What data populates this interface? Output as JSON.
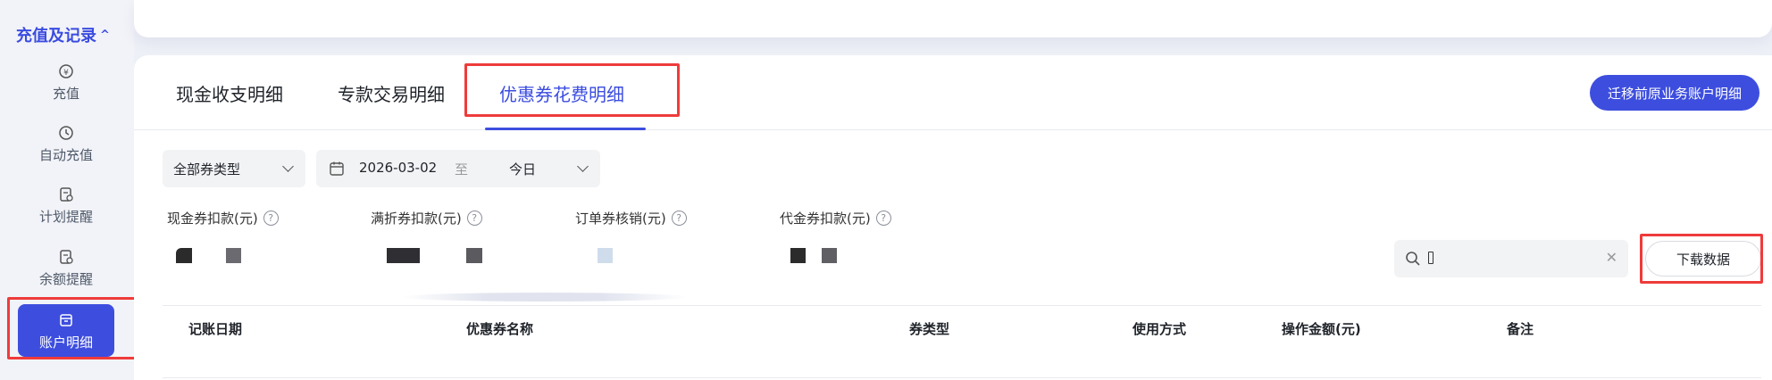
{
  "sidebar": {
    "section_title": "充值及记录",
    "items": [
      {
        "label": "充值"
      },
      {
        "label": "自动充值"
      },
      {
        "label": "计划提醒"
      },
      {
        "label": "余额提醒"
      },
      {
        "label": "账户明细"
      }
    ]
  },
  "tabs": [
    {
      "label": "现金收支明细",
      "active": false
    },
    {
      "label": "专款交易明细",
      "active": false
    },
    {
      "label": "优惠券花费明细",
      "active": true
    }
  ],
  "migrate_button": "迁移前原业务账户明细",
  "filters": {
    "coupon_type": "全部券类型",
    "date_start": "2026-03-02",
    "date_sep": "至",
    "date_end": "今日"
  },
  "summaries": [
    {
      "label": "现金券扣款(元)"
    },
    {
      "label": "满折券扣款(元)"
    },
    {
      "label": "订单券核销(元)"
    },
    {
      "label": "代金券扣款(元)"
    }
  ],
  "search": {
    "value": "",
    "placeholder": ""
  },
  "download_button": "下载数据",
  "table": {
    "columns": [
      "记账日期",
      "优惠券名称",
      "券类型",
      "使用方式",
      "操作金额(元)",
      "备注"
    ]
  },
  "colors": {
    "accent": "#3d4ede",
    "highlight": "#ef3b3b"
  }
}
